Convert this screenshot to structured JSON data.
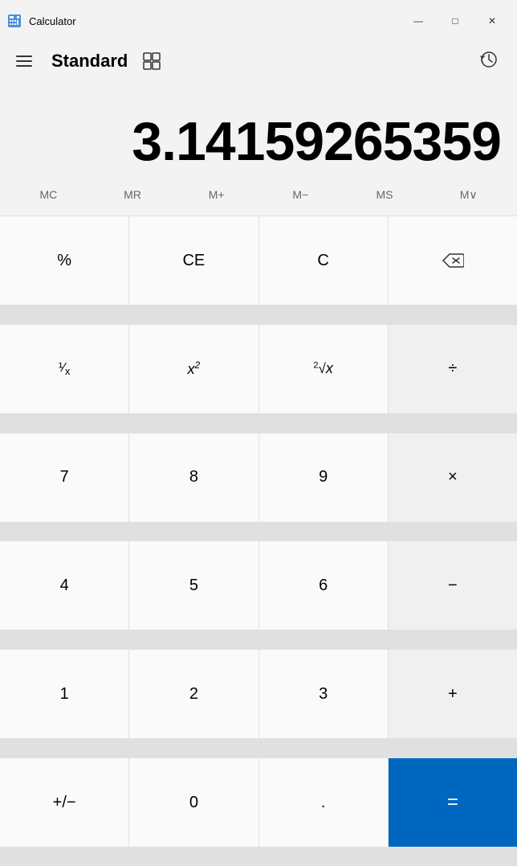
{
  "titleBar": {
    "appName": "Calculator",
    "minimizeLabel": "—",
    "maximizeLabel": "□",
    "closeLabel": "✕"
  },
  "header": {
    "title": "Standard",
    "menuLabel": "menu"
  },
  "display": {
    "value": "3.14159265359"
  },
  "memoryRow": {
    "buttons": [
      "MC",
      "MR",
      "M+",
      "M−",
      "MS",
      "M∨"
    ]
  },
  "buttons": [
    [
      {
        "label": "%",
        "name": "percent",
        "type": "function"
      },
      {
        "label": "CE",
        "name": "ce",
        "type": "function"
      },
      {
        "label": "C",
        "name": "clear",
        "type": "function"
      },
      {
        "label": "⌫",
        "name": "backspace",
        "type": "function"
      }
    ],
    [
      {
        "label": "¹⁄ₓ",
        "name": "reciprocal",
        "type": "function"
      },
      {
        "label": "x²",
        "name": "square",
        "type": "function"
      },
      {
        "label": "²√x",
        "name": "sqrt",
        "type": "function"
      },
      {
        "label": "÷",
        "name": "divide",
        "type": "operator"
      }
    ],
    [
      {
        "label": "7",
        "name": "seven",
        "type": "digit"
      },
      {
        "label": "8",
        "name": "eight",
        "type": "digit"
      },
      {
        "label": "9",
        "name": "nine",
        "type": "digit"
      },
      {
        "label": "×",
        "name": "multiply",
        "type": "operator"
      }
    ],
    [
      {
        "label": "4",
        "name": "four",
        "type": "digit"
      },
      {
        "label": "5",
        "name": "five",
        "type": "digit"
      },
      {
        "label": "6",
        "name": "six",
        "type": "digit"
      },
      {
        "label": "−",
        "name": "subtract",
        "type": "operator"
      }
    ],
    [
      {
        "label": "1",
        "name": "one",
        "type": "digit"
      },
      {
        "label": "2",
        "name": "two",
        "type": "digit"
      },
      {
        "label": "3",
        "name": "three",
        "type": "digit"
      },
      {
        "label": "+",
        "name": "add",
        "type": "operator"
      }
    ],
    [
      {
        "label": "+/−",
        "name": "negate",
        "type": "function"
      },
      {
        "label": "0",
        "name": "zero",
        "type": "digit"
      },
      {
        "label": ".",
        "name": "decimal",
        "type": "digit"
      },
      {
        "label": "=",
        "name": "equals",
        "type": "equals"
      }
    ]
  ]
}
